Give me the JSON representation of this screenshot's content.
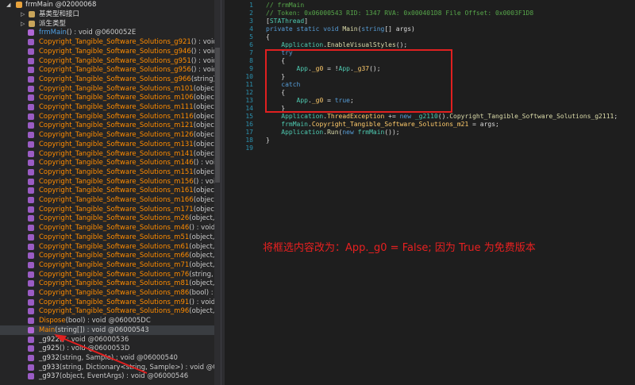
{
  "tree": {
    "header": {
      "label": "frmMain @02000068"
    },
    "items": [
      {
        "kind": "folder",
        "indent": true,
        "expander": "▷",
        "text": "基类型和接口"
      },
      {
        "kind": "folder",
        "indent": true,
        "expander": "▷",
        "text": "派生类型"
      },
      {
        "kind": "method",
        "name": "frmMain",
        "sig": "() : void @0600052E",
        "nameColor": "blue"
      },
      {
        "kind": "private",
        "name": "Copyright_Tangible_Software_Solutions_g921",
        "sig": "() : void @",
        "nameColor": "orange"
      },
      {
        "kind": "private",
        "name": "Copyright_Tangible_Software_Solutions_g946",
        "sig": "() : void @",
        "nameColor": "orange"
      },
      {
        "kind": "private",
        "name": "Copyright_Tangible_Software_Solutions_g951",
        "sig": "() : void @",
        "nameColor": "orange"
      },
      {
        "kind": "private",
        "name": "Copyright_Tangible_Software_Solutions_g956",
        "sig": "() : void @",
        "nameColor": "orange"
      },
      {
        "kind": "private",
        "name": "Copyright_Tangible_Software_Solutions_g966",
        "sig": "(string) : v",
        "nameColor": "orange"
      },
      {
        "kind": "private",
        "name": "Copyright_Tangible_Software_Solutions_m101",
        "sig": "(object, E",
        "nameColor": "orange"
      },
      {
        "kind": "private",
        "name": "Copyright_Tangible_Software_Solutions_m106",
        "sig": "(object, E",
        "nameColor": "orange"
      },
      {
        "kind": "private",
        "name": "Copyright_Tangible_Software_Solutions_m111",
        "sig": "(object, E",
        "nameColor": "orange"
      },
      {
        "kind": "private",
        "name": "Copyright_Tangible_Software_Solutions_m116",
        "sig": "(object, E",
        "nameColor": "orange"
      },
      {
        "kind": "private",
        "name": "Copyright_Tangible_Software_Solutions_m121",
        "sig": "(object, E",
        "nameColor": "orange"
      },
      {
        "kind": "private",
        "name": "Copyright_Tangible_Software_Solutions_m126",
        "sig": "(object, E",
        "nameColor": "orange"
      },
      {
        "kind": "private",
        "name": "Copyright_Tangible_Software_Solutions_m131",
        "sig": "(object, E",
        "nameColor": "orange"
      },
      {
        "kind": "private",
        "name": "Copyright_Tangible_Software_Solutions_m141",
        "sig": "(object, E",
        "nameColor": "orange"
      },
      {
        "kind": "private",
        "name": "Copyright_Tangible_Software_Solutions_m146",
        "sig": "() : void @",
        "nameColor": "orange"
      },
      {
        "kind": "private",
        "name": "Copyright_Tangible_Software_Solutions_m151",
        "sig": "(object, E",
        "nameColor": "orange"
      },
      {
        "kind": "private",
        "name": "Copyright_Tangible_Software_Solutions_m156",
        "sig": "() : void @",
        "nameColor": "orange"
      },
      {
        "kind": "private",
        "name": "Copyright_Tangible_Software_Solutions_m161",
        "sig": "(object, E",
        "nameColor": "orange"
      },
      {
        "kind": "private",
        "name": "Copyright_Tangible_Software_Solutions_m166",
        "sig": "(object, E",
        "nameColor": "orange"
      },
      {
        "kind": "private",
        "name": "Copyright_Tangible_Software_Solutions_m171",
        "sig": "(object, E",
        "nameColor": "orange"
      },
      {
        "kind": "private",
        "name": "Copyright_Tangible_Software_Solutions_m26",
        "sig": "(object, Ev",
        "nameColor": "orange"
      },
      {
        "kind": "private",
        "name": "Copyright_Tangible_Software_Solutions_m46",
        "sig": "() : void @",
        "nameColor": "orange"
      },
      {
        "kind": "private",
        "name": "Copyright_Tangible_Software_Solutions_m51",
        "sig": "(object, Ca",
        "nameColor": "orange"
      },
      {
        "kind": "private",
        "name": "Copyright_Tangible_Software_Solutions_m61",
        "sig": "(object, Lin",
        "nameColor": "orange"
      },
      {
        "kind": "private",
        "name": "Copyright_Tangible_Software_Solutions_m66",
        "sig": "(object, Ev",
        "nameColor": "orange"
      },
      {
        "kind": "private",
        "name": "Copyright_Tangible_Software_Solutions_m71",
        "sig": "(object, Ev",
        "nameColor": "orange"
      },
      {
        "kind": "private",
        "name": "Copyright_Tangible_Software_Solutions_m76",
        "sig": "(string, str",
        "nameColor": "orange"
      },
      {
        "kind": "private",
        "name": "Copyright_Tangible_Software_Solutions_m81",
        "sig": "(object, Ev",
        "nameColor": "orange"
      },
      {
        "kind": "private",
        "name": "Copyright_Tangible_Software_Solutions_m86",
        "sig": "(bool) : vo",
        "nameColor": "orange"
      },
      {
        "kind": "private",
        "name": "Copyright_Tangible_Software_Solutions_m91",
        "sig": "() : void @",
        "nameColor": "orange"
      },
      {
        "kind": "private",
        "name": "Copyright_Tangible_Software_Solutions_m96",
        "sig": "(object, Ev",
        "nameColor": "orange"
      },
      {
        "kind": "private",
        "name": "Dispose",
        "sig": "(bool) : void @060005DC",
        "nameColor": "orange"
      },
      {
        "kind": "method",
        "name": "Main",
        "sig": "(string[]) : void @06000543",
        "nameColor": "orange",
        "selected": true
      },
      {
        "kind": "private",
        "name": "_g922",
        "sig": "() : void @06000536",
        "nameColor": "white"
      },
      {
        "kind": "private",
        "name": "_g925",
        "sig": "() : void @0600053D",
        "nameColor": "white"
      },
      {
        "kind": "private",
        "name": "_g932",
        "sig": "(string, Sample) : void @06000540",
        "nameColor": "white"
      },
      {
        "kind": "private",
        "name": "_g933",
        "sig": "(string, Dictionary<string, Sample>) : void @060",
        "nameColor": "white"
      },
      {
        "kind": "private",
        "name": "_g937",
        "sig": "(object, EventArgs) : void @06000546",
        "nameColor": "white"
      }
    ]
  },
  "code": {
    "lines": [
      {
        "n": "1",
        "tokens": [
          {
            "c": "cm",
            "t": "// frmMain"
          }
        ]
      },
      {
        "n": "2",
        "tokens": [
          {
            "c": "cm",
            "t": "// Token: 0x06000543 RID: 1347 RVA: 0x000401D8 File Offset: 0x0003F1D8"
          }
        ]
      },
      {
        "n": "3",
        "tokens": [
          {
            "c": "t",
            "t": "["
          },
          {
            "c": "ty",
            "t": "STAThread"
          },
          {
            "c": "t",
            "t": "]"
          }
        ]
      },
      {
        "n": "4",
        "tokens": [
          {
            "c": "k",
            "t": "private static void "
          },
          {
            "c": "m",
            "t": "Main"
          },
          {
            "c": "t",
            "t": "("
          },
          {
            "c": "k",
            "t": "string"
          },
          {
            "c": "t",
            "t": "[] args)"
          }
        ]
      },
      {
        "n": "5",
        "tokens": [
          {
            "c": "t",
            "t": "{"
          }
        ]
      },
      {
        "n": "6",
        "tokens": [
          {
            "c": "t",
            "t": "    "
          },
          {
            "c": "ty",
            "t": "Application"
          },
          {
            "c": "t",
            "t": "."
          },
          {
            "c": "m",
            "t": "EnableVisualStyles"
          },
          {
            "c": "t",
            "t": "();"
          }
        ]
      },
      {
        "n": "7",
        "tokens": [
          {
            "c": "t",
            "t": "    "
          },
          {
            "c": "k",
            "t": "try"
          }
        ]
      },
      {
        "n": "8",
        "tokens": [
          {
            "c": "t",
            "t": "    {"
          }
        ]
      },
      {
        "n": "9",
        "tokens": [
          {
            "c": "t",
            "t": "        "
          },
          {
            "c": "ty",
            "t": "App"
          },
          {
            "c": "t",
            "t": "."
          },
          {
            "c": "f",
            "t": "_g0"
          },
          {
            "c": "t",
            "t": " = !"
          },
          {
            "c": "ty",
            "t": "App"
          },
          {
            "c": "t",
            "t": "."
          },
          {
            "c": "f",
            "t": "_g37"
          },
          {
            "c": "t",
            "t": "();"
          }
        ]
      },
      {
        "n": "10",
        "tokens": [
          {
            "c": "t",
            "t": "    }"
          }
        ]
      },
      {
        "n": "11",
        "tokens": [
          {
            "c": "t",
            "t": "    "
          },
          {
            "c": "k",
            "t": "catch"
          }
        ]
      },
      {
        "n": "12",
        "tokens": [
          {
            "c": "t",
            "t": "    {"
          }
        ]
      },
      {
        "n": "13",
        "tokens": [
          {
            "c": "t",
            "t": "        "
          },
          {
            "c": "ty",
            "t": "App"
          },
          {
            "c": "t",
            "t": "."
          },
          {
            "c": "f",
            "t": "_g0"
          },
          {
            "c": "t",
            "t": " = "
          },
          {
            "c": "k",
            "t": "true"
          },
          {
            "c": "t",
            "t": ";"
          }
        ]
      },
      {
        "n": "14",
        "tokens": [
          {
            "c": "t",
            "t": "    }"
          }
        ]
      },
      {
        "n": "15",
        "tokens": [
          {
            "c": "t",
            "t": "    "
          },
          {
            "c": "ty",
            "t": "Application"
          },
          {
            "c": "t",
            "t": "."
          },
          {
            "c": "f",
            "t": "ThreadException"
          },
          {
            "c": "t",
            "t": " += "
          },
          {
            "c": "k",
            "t": "new "
          },
          {
            "c": "ty",
            "t": "_g2110"
          },
          {
            "c": "t",
            "t": "()."
          },
          {
            "c": "m",
            "t": "Copyright_Tangible_Software_Solutions_g2111"
          },
          {
            "c": "t",
            "t": ";"
          }
        ]
      },
      {
        "n": "16",
        "tokens": [
          {
            "c": "t",
            "t": "    "
          },
          {
            "c": "ty",
            "t": "frmMain"
          },
          {
            "c": "t",
            "t": "."
          },
          {
            "c": "f",
            "t": "Copyright_Tangible_Software_Solutions_m21"
          },
          {
            "c": "t",
            "t": " = args;"
          }
        ]
      },
      {
        "n": "17",
        "tokens": [
          {
            "c": "t",
            "t": "    "
          },
          {
            "c": "ty",
            "t": "Application"
          },
          {
            "c": "t",
            "t": "."
          },
          {
            "c": "m",
            "t": "Run"
          },
          {
            "c": "t",
            "t": "("
          },
          {
            "c": "k",
            "t": "new "
          },
          {
            "c": "ty",
            "t": "frmMain"
          },
          {
            "c": "t",
            "t": "());"
          }
        ]
      },
      {
        "n": "18",
        "tokens": [
          {
            "c": "t",
            "t": "}"
          }
        ]
      },
      {
        "n": "19",
        "tokens": []
      }
    ]
  },
  "annotation": {
    "text": "将框选内容改为：App._g0 = False;  因为 True 为免费版本"
  },
  "colors": {
    "annotation_red": "#e82020",
    "method_orange": "#ff8c00",
    "link_blue": "#4e9de0"
  }
}
